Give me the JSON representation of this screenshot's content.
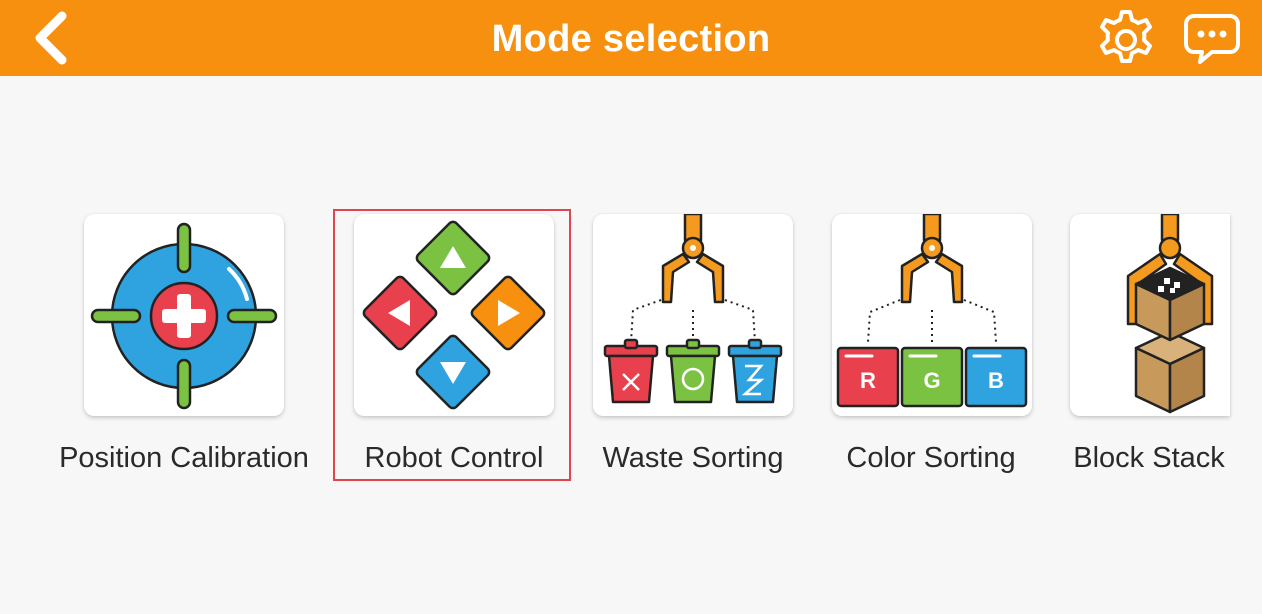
{
  "header": {
    "title": "Mode selection",
    "back_icon": "chevron-left-icon",
    "settings_icon": "gear-icon",
    "chat_icon": "chat-bubble-icon",
    "bar_color": "#f7900f"
  },
  "modes": [
    {
      "label": "Position Calibration",
      "icon": "crosshair-plus-icon",
      "selected": false
    },
    {
      "label": "Robot Control",
      "icon": "directional-pad-icon",
      "selected": true
    },
    {
      "label": "Waste Sorting",
      "icon": "gripper-trash-bins-icon",
      "selected": false
    },
    {
      "label": "Color Sorting",
      "icon": "gripper-rgb-blocks-icon",
      "selected": false
    },
    {
      "label": "Block Stack",
      "icon": "gripper-stacked-blocks-icon",
      "selected": false
    }
  ],
  "cards": {
    "color_sorting_blocks": [
      "R",
      "G",
      "B"
    ]
  },
  "selection_color": "#e0454d"
}
